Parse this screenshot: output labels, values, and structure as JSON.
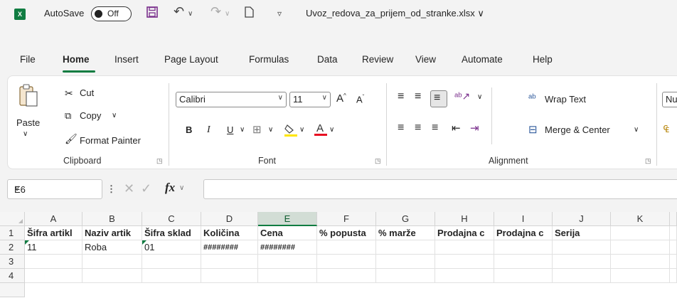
{
  "titlebar": {
    "app_icon": "excel-icon",
    "autosave_label": "AutoSave",
    "autosave_state": "Off",
    "filename": "Uvoz_redova_za_prijem_od_stranke.xlsx ∨"
  },
  "menu": {
    "tabs": [
      "File",
      "Home",
      "Insert",
      "Page Layout",
      "Formulas",
      "Data",
      "Review",
      "View",
      "Automate",
      "Help"
    ],
    "active": "Home"
  },
  "ribbon": {
    "clipboard": {
      "paste": "Paste",
      "cut": "Cut",
      "copy": "Copy",
      "format_painter": "Format Painter",
      "label": "Clipboard"
    },
    "font": {
      "font_name": "Calibri",
      "font_size": "11",
      "bold": "B",
      "italic": "I",
      "underline": "U",
      "label": "Font"
    },
    "alignment": {
      "wrap_text": "Wrap Text",
      "merge_center": "Merge & Center",
      "label": "Alignment"
    },
    "number": {
      "format_partial": "Nu"
    }
  },
  "formula_bar": {
    "cell_ref": "E6",
    "fx": "fx",
    "value": ""
  },
  "sheet": {
    "columns": [
      "A",
      "B",
      "C",
      "D",
      "E",
      "F",
      "G",
      "H",
      "I",
      "J",
      "K"
    ],
    "selected_column": "E",
    "rows": [
      "1",
      "2",
      "3",
      "4"
    ],
    "row1": [
      "Šifra artikl",
      "Naziv artik",
      "Šifra sklad",
      "Količina",
      "Cena",
      "% popusta",
      "% marže",
      "Prodajna c",
      "Prodajna c",
      "Serija",
      ""
    ],
    "row2": [
      "11",
      "Roba",
      "01",
      "########",
      "########",
      "",
      "",
      "",
      "",
      "",
      ""
    ]
  },
  "colors": {
    "accent": "#107c41",
    "selected_header": "#d2ddd5"
  }
}
